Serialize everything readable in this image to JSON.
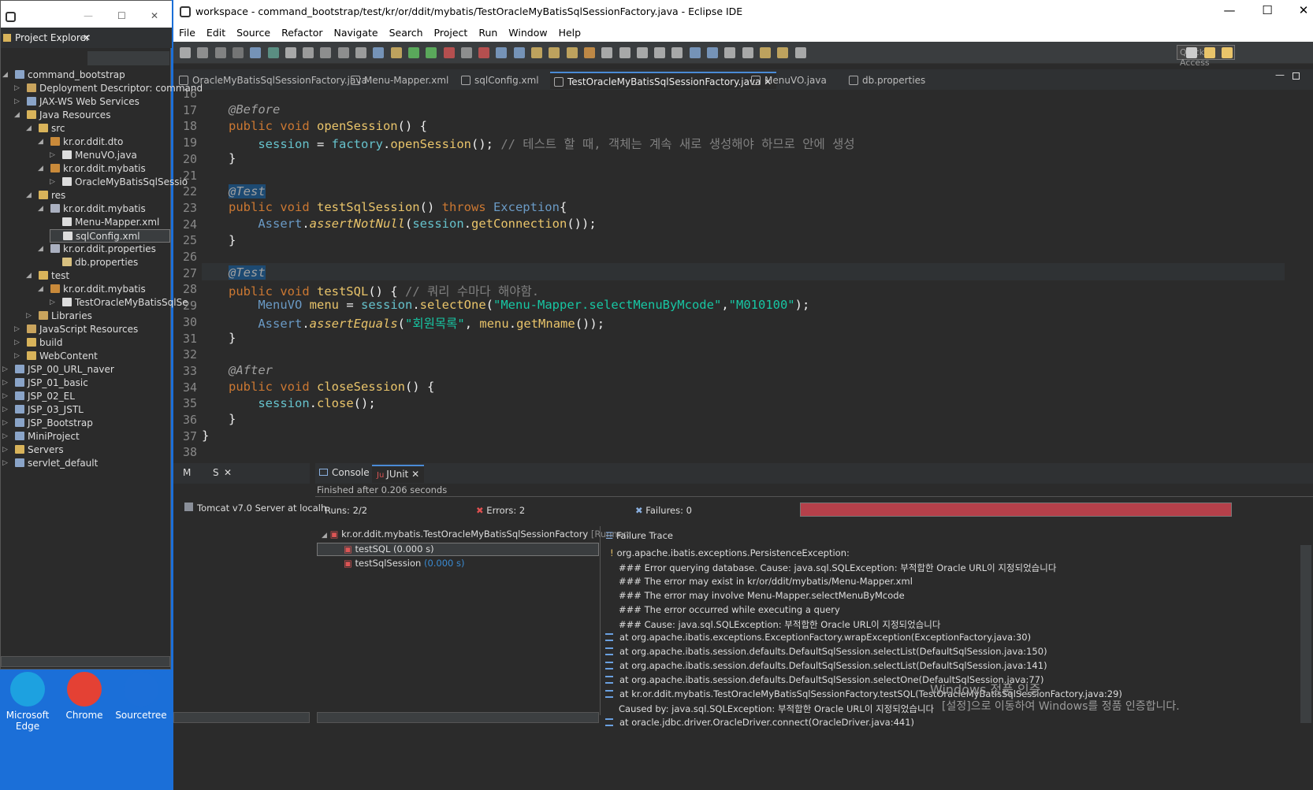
{
  "desktop": {
    "icons": [
      {
        "label": "Microsoft Edge",
        "color": "#1da1e0"
      },
      {
        "label": "Chrome",
        "color": "#e44134"
      },
      {
        "label": "Sourcetree",
        "color": "#1c6fd8"
      }
    ]
  },
  "window": {
    "title": "workspace - command_bootstrap/test/kr/or/ddit/mybatis/TestOracleMyBatisSqlSessionFactory.java - Eclipse IDE"
  },
  "menu": [
    "File",
    "Edit",
    "Source",
    "Refactor",
    "Navigate",
    "Search",
    "Project",
    "Run",
    "Window",
    "Help"
  ],
  "quick_access": "Quick Access",
  "editor_tabs": [
    {
      "label": "OracleMyBatisSqlSessionFactory.java"
    },
    {
      "label": "Menu-Mapper.xml"
    },
    {
      "label": "sqlConfig.xml"
    },
    {
      "label": "TestOracleMyBatisSqlSessionFactory.java",
      "active": true
    },
    {
      "label": "MenuVO.java"
    },
    {
      "label": "db.properties"
    }
  ],
  "code": {
    "line_numbers": [
      "16",
      "17",
      "18",
      "19",
      "20",
      "21",
      "22",
      "23",
      "24",
      "25",
      "26",
      "27",
      "28",
      "29",
      "30",
      "31",
      "32",
      "33",
      "34",
      "35",
      "36",
      "37",
      "38"
    ]
  },
  "project_explorer": {
    "title": "Project Explorer",
    "items": [
      {
        "label": "command_bootstrap",
        "depth": 0,
        "tw": "◢",
        "ic": "#8aa4c8"
      },
      {
        "label": "Deployment Descriptor: command",
        "depth": 1,
        "tw": "▷",
        "ic": "#c9a45d"
      },
      {
        "label": "JAX-WS Web Services",
        "depth": 1,
        "tw": "▷",
        "ic": "#8aa4c8"
      },
      {
        "label": "Java Resources",
        "depth": 1,
        "tw": "◢",
        "ic": "#d8b35a"
      },
      {
        "label": "src",
        "depth": 2,
        "tw": "◢",
        "ic": "#d8b35a"
      },
      {
        "label": "kr.or.ddit.dto",
        "depth": 3,
        "tw": "◢",
        "ic": "#c98a3a"
      },
      {
        "label": "MenuVO.java",
        "depth": 4,
        "tw": "▷",
        "ic": "#dddddd"
      },
      {
        "label": "kr.or.ddit.mybatis",
        "depth": 3,
        "tw": "◢",
        "ic": "#c98a3a"
      },
      {
        "label": "OracleMyBatisSqlSessio",
        "depth": 4,
        "tw": "▷",
        "ic": "#dddddd"
      },
      {
        "label": "res",
        "depth": 2,
        "tw": "◢",
        "ic": "#d8b35a"
      },
      {
        "label": "kr.or.ddit.mybatis",
        "depth": 3,
        "tw": "◢",
        "ic": "#aab0c0"
      },
      {
        "label": "Menu-Mapper.xml",
        "depth": 4,
        "tw": "",
        "ic": "#dddddd"
      },
      {
        "label": "sqlConfig.xml",
        "depth": 4,
        "tw": "",
        "ic": "#dddddd",
        "selected": true
      },
      {
        "label": "kr.or.ddit.properties",
        "depth": 3,
        "tw": "◢",
        "ic": "#aab0c0"
      },
      {
        "label": "db.properties",
        "depth": 4,
        "tw": "",
        "ic": "#d8c080"
      },
      {
        "label": "test",
        "depth": 2,
        "tw": "◢",
        "ic": "#d8b35a"
      },
      {
        "label": "kr.or.ddit.mybatis",
        "depth": 3,
        "tw": "◢",
        "ic": "#c98a3a"
      },
      {
        "label": "TestOracleMyBatisSqlSe",
        "depth": 4,
        "tw": "▷",
        "ic": "#dddddd"
      },
      {
        "label": "Libraries",
        "depth": 2,
        "tw": "▷",
        "ic": "#c9a45d"
      },
      {
        "label": "JavaScript Resources",
        "depth": 1,
        "tw": "▷",
        "ic": "#c9a45d"
      },
      {
        "label": "build",
        "depth": 1,
        "tw": "▷",
        "ic": "#d8b35a"
      },
      {
        "label": "WebContent",
        "depth": 1,
        "tw": "▷",
        "ic": "#d8b35a"
      },
      {
        "label": "JSP_00_URL_naver",
        "depth": 0,
        "tw": "▷",
        "ic": "#8aa4c8"
      },
      {
        "label": "JSP_01_basic",
        "depth": 0,
        "tw": "▷",
        "ic": "#8aa4c8"
      },
      {
        "label": "JSP_02_EL",
        "depth": 0,
        "tw": "▷",
        "ic": "#8aa4c8"
      },
      {
        "label": "JSP_03_JSTL",
        "depth": 0,
        "tw": "▷",
        "ic": "#8aa4c8"
      },
      {
        "label": "JSP_Bootstrap",
        "depth": 0,
        "tw": "▷",
        "ic": "#8aa4c8"
      },
      {
        "label": "MiniProject",
        "depth": 0,
        "tw": "▷",
        "ic": "#8aa4c8"
      },
      {
        "label": "Servers",
        "depth": 0,
        "tw": "▷",
        "ic": "#d8b35a"
      },
      {
        "label": "servlet_default",
        "depth": 0,
        "tw": "▷",
        "ic": "#8aa4c8"
      }
    ]
  },
  "servers_panel": {
    "tab_m": "M",
    "tab_s": "S",
    "server": "Tomcat v7.0 Server at localh"
  },
  "console_tab": "Console",
  "junit": {
    "tab": "JUnit",
    "finished": "Finished after 0.206 seconds",
    "runs_label": "Runs:",
    "runs": "2/2",
    "errors_label": "Errors:",
    "errors": "2",
    "failures_label": "Failures:",
    "failures": "0",
    "bar_color": "#b5404a",
    "suite": "kr.or.ddit.mybatis.TestOracleMyBatisSqlSessionFactory",
    "suite_runner": "[Runner:",
    "tests": [
      {
        "name": "testSQL",
        "time": "(0.000 s)"
      },
      {
        "name": "testSqlSession",
        "time": "(0.000 s)"
      }
    ],
    "failure_trace_title": "Failure Trace",
    "trace": [
      {
        "text": "org.apache.ibatis.exceptions.PersistenceException:",
        "icon": "warn"
      },
      {
        "text": "### Error querying database.  Cause: java.sql.SQLException: 부적합한 Oracle URL이 지정되었습니다",
        "icon": ""
      },
      {
        "text": "### The error may exist in kr/or/ddit/mybatis/Menu-Mapper.xml",
        "icon": ""
      },
      {
        "text": "### The error may involve Menu-Mapper.selectMenuByMcode",
        "icon": ""
      },
      {
        "text": "### The error occurred while executing a query",
        "icon": ""
      },
      {
        "text": "### Cause: java.sql.SQLException: 부적합한 Oracle URL이 지정되었습니다",
        "icon": ""
      },
      {
        "text": "at org.apache.ibatis.exceptions.ExceptionFactory.wrapException(ExceptionFactory.java:30)",
        "icon": "stack"
      },
      {
        "text": "at org.apache.ibatis.session.defaults.DefaultSqlSession.selectList(DefaultSqlSession.java:150)",
        "icon": "stack"
      },
      {
        "text": "at org.apache.ibatis.session.defaults.DefaultSqlSession.selectList(DefaultSqlSession.java:141)",
        "icon": "stack"
      },
      {
        "text": "at org.apache.ibatis.session.defaults.DefaultSqlSession.selectOne(DefaultSqlSession.java:77)",
        "icon": "stack"
      },
      {
        "text": "at kr.or.ddit.mybatis.TestOracleMyBatisSqlSessionFactory.testSQL(TestOracleMyBatisSqlSessionFactory.java:29)",
        "icon": "stack"
      },
      {
        "text": "Caused by: java.sql.SQLException: 부적합한 Oracle URL이 지정되었습니다",
        "icon": ""
      },
      {
        "text": "at oracle.jdbc.driver.OracleDriver.connect(OracleDriver.java:441)",
        "icon": "stack"
      }
    ]
  },
  "watermark": {
    "line1": "Windows 정품 인증",
    "line2": "[설정]으로 이동하여 Windows를 정품 인증합니다."
  }
}
